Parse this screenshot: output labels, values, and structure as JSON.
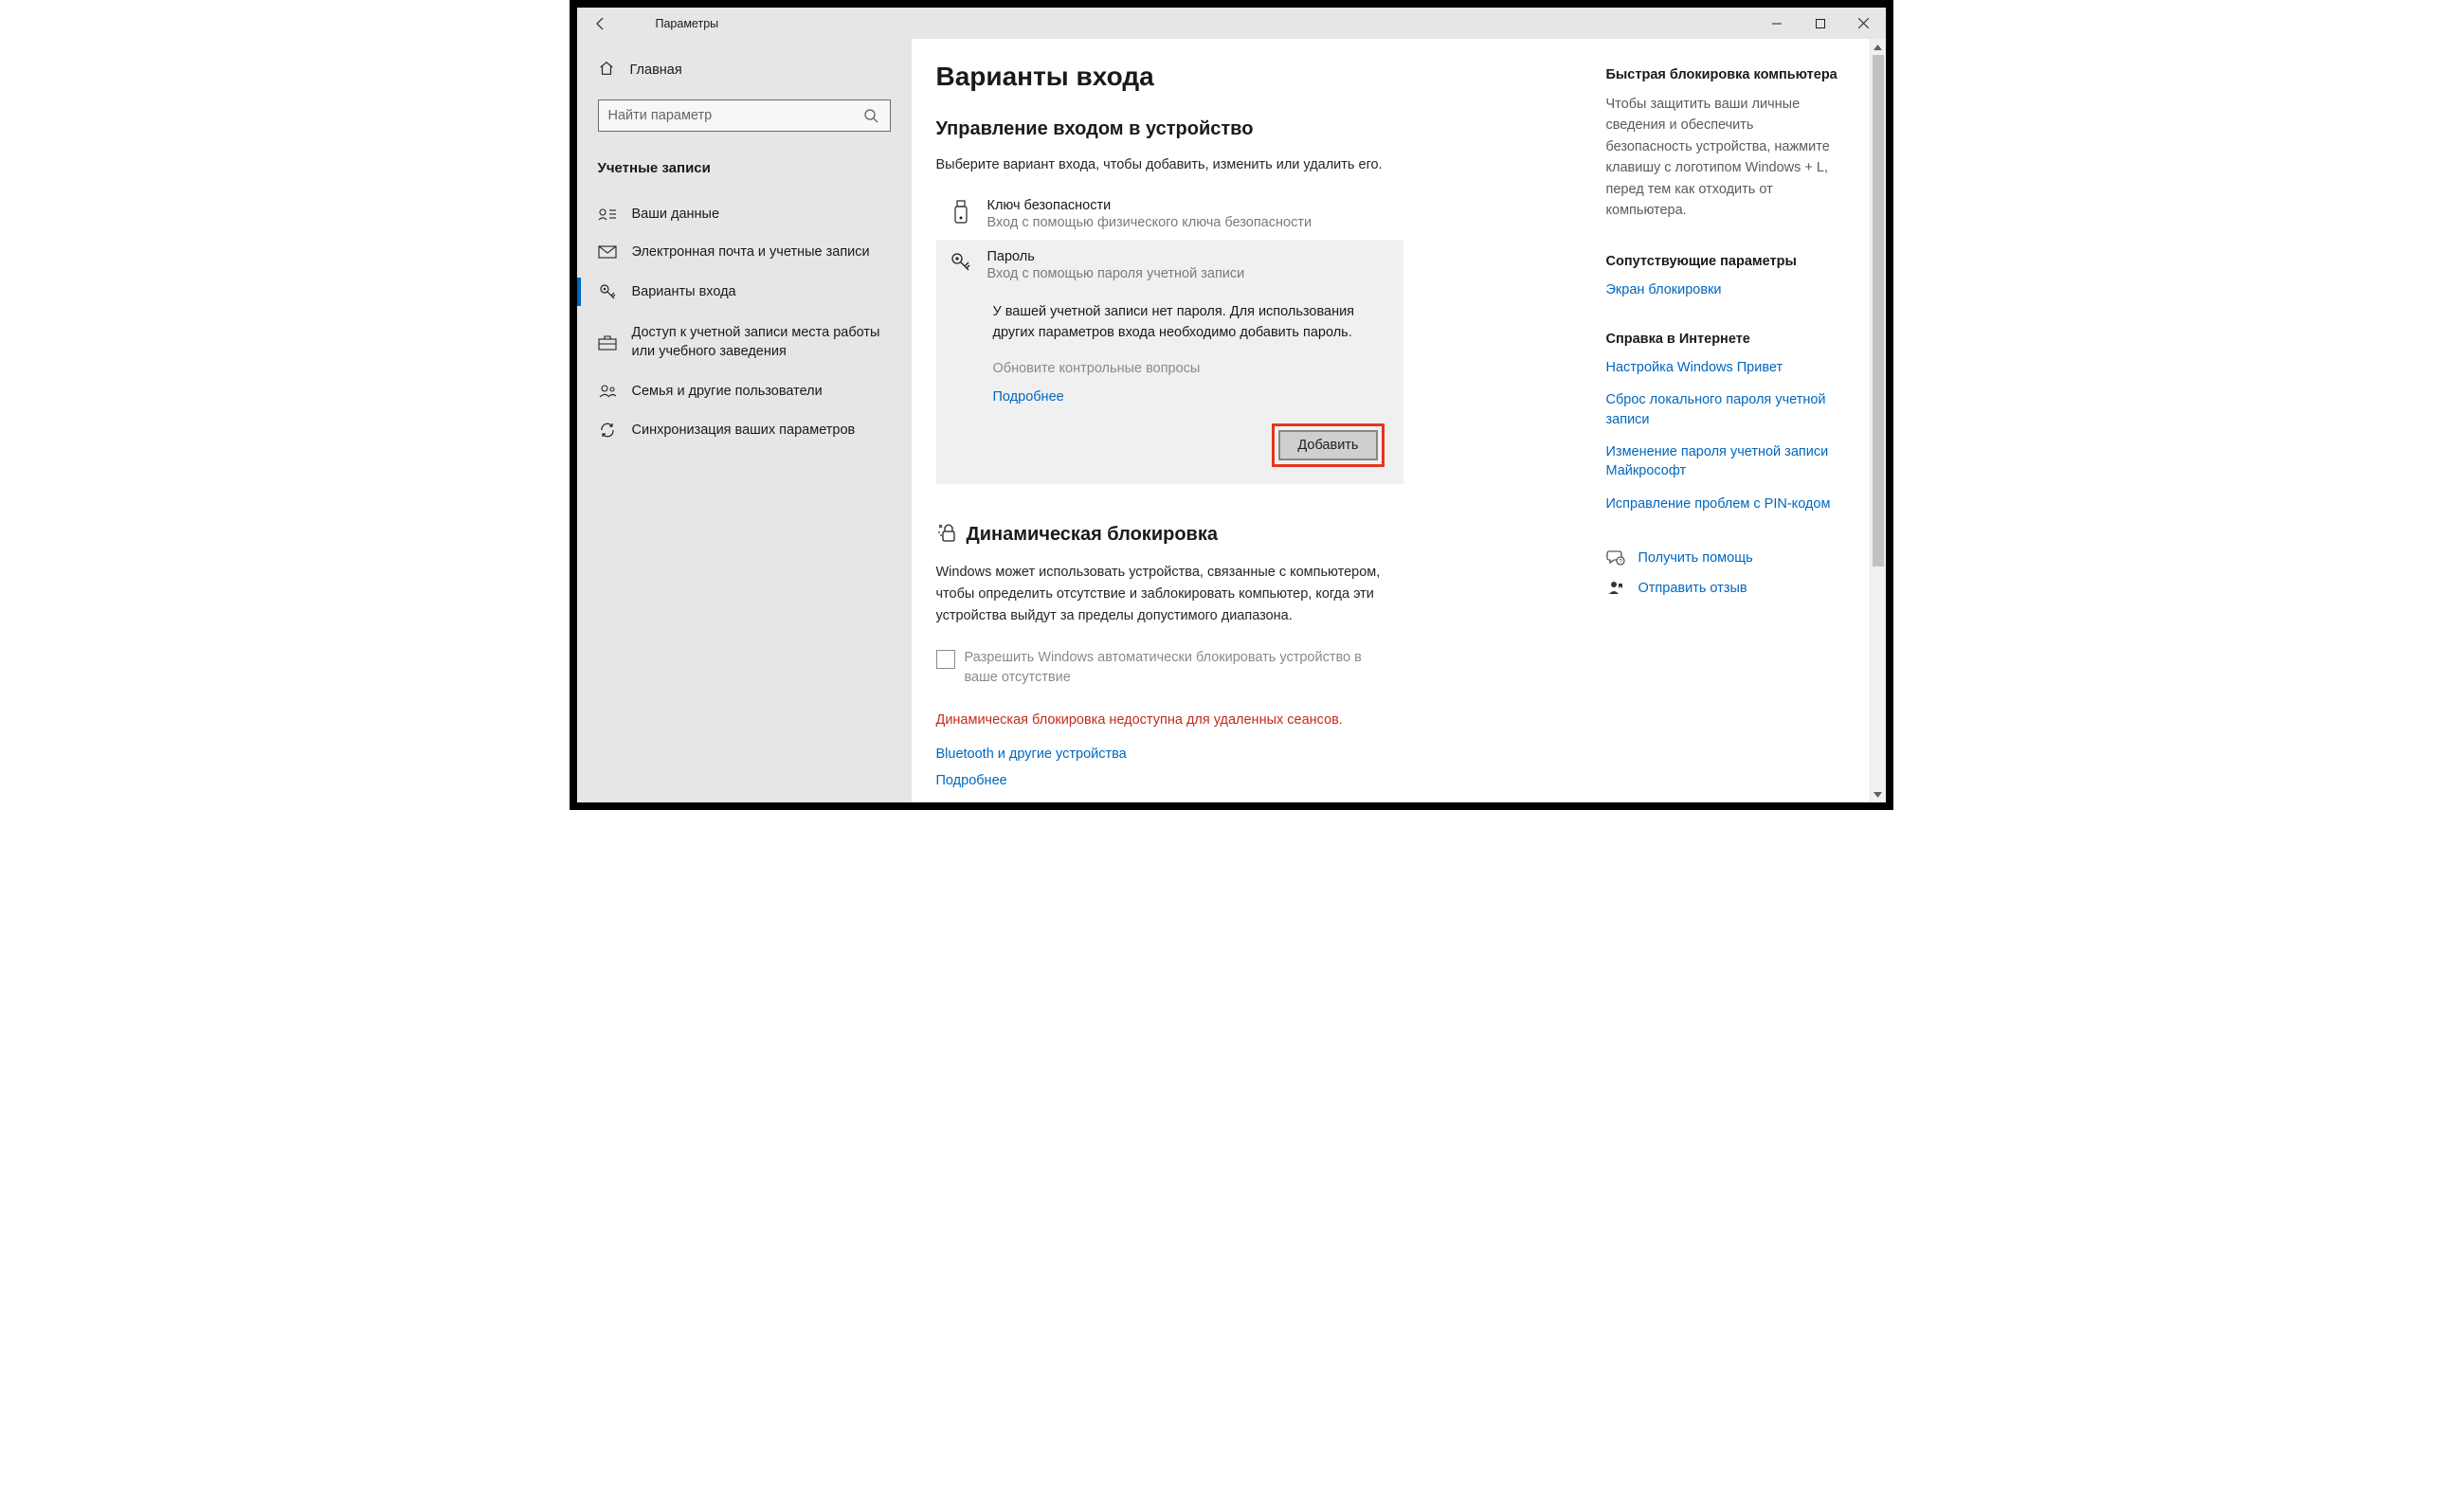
{
  "titlebar": {
    "title": "Параметры"
  },
  "sidebar": {
    "home_label": "Главная",
    "search_placeholder": "Найти параметр",
    "section_title": "Учетные записи",
    "items": [
      {
        "label": "Ваши данные"
      },
      {
        "label": "Электронная почта и учетные записи"
      },
      {
        "label": "Варианты входа"
      },
      {
        "label": "Доступ к учетной записи места работы или учебного заведения"
      },
      {
        "label": "Семья и другие пользователи"
      },
      {
        "label": "Синхронизация ваших параметров"
      }
    ]
  },
  "main": {
    "page_title": "Варианты входа",
    "section1_heading": "Управление входом в устройство",
    "section1_instr": "Выберите вариант входа, чтобы добавить, изменить или удалить его.",
    "opt_security_key": {
      "title": "Ключ безопасности",
      "sub": "Вход с помощью физического ключа безопасности"
    },
    "opt_password": {
      "title": "Пароль",
      "sub": "Вход с помощью пароля учетной записи"
    },
    "pwd_desc": "У вашей учетной записи нет пароля. Для использования других параметров входа необходимо добавить пароль.",
    "pwd_disabled": "Обновите контрольные вопросы",
    "pwd_more": "Подробнее",
    "add_btn": "Добавить",
    "dyn_heading": "Динамическая блокировка",
    "dyn_desc": "Windows может использовать устройства, связанные с компьютером, чтобы определить отсутствие и заблокировать компьютер, когда эти устройства выйдут за пределы допустимого диапазона.",
    "dyn_checkbox": "Разрешить Windows автоматически блокировать устройство в ваше отсутствие",
    "dyn_error": "Динамическая блокировка недоступна для удаленных сеансов.",
    "dyn_link1": "Bluetooth и другие устройства",
    "dyn_link2": "Подробнее"
  },
  "right": {
    "quick_lock_heading": "Быстрая блокировка компьютера",
    "quick_lock_text": "Чтобы защитить ваши личные сведения и обеспечить безопасность устройства, нажмите клавишу с логотипом Windows + L, перед тем как отходить от компьютера.",
    "related_heading": "Сопутствующие параметры",
    "related_link": "Экран блокировки",
    "help_heading": "Справка в Интернете",
    "help_links": [
      "Настройка Windows Привет",
      "Сброс локального пароля учетной записи",
      "Изменение пароля учетной записи Майкрософт",
      "Исправление проблем с PIN-кодом"
    ],
    "get_help": "Получить помощь",
    "feedback": "Отправить отзыв"
  }
}
